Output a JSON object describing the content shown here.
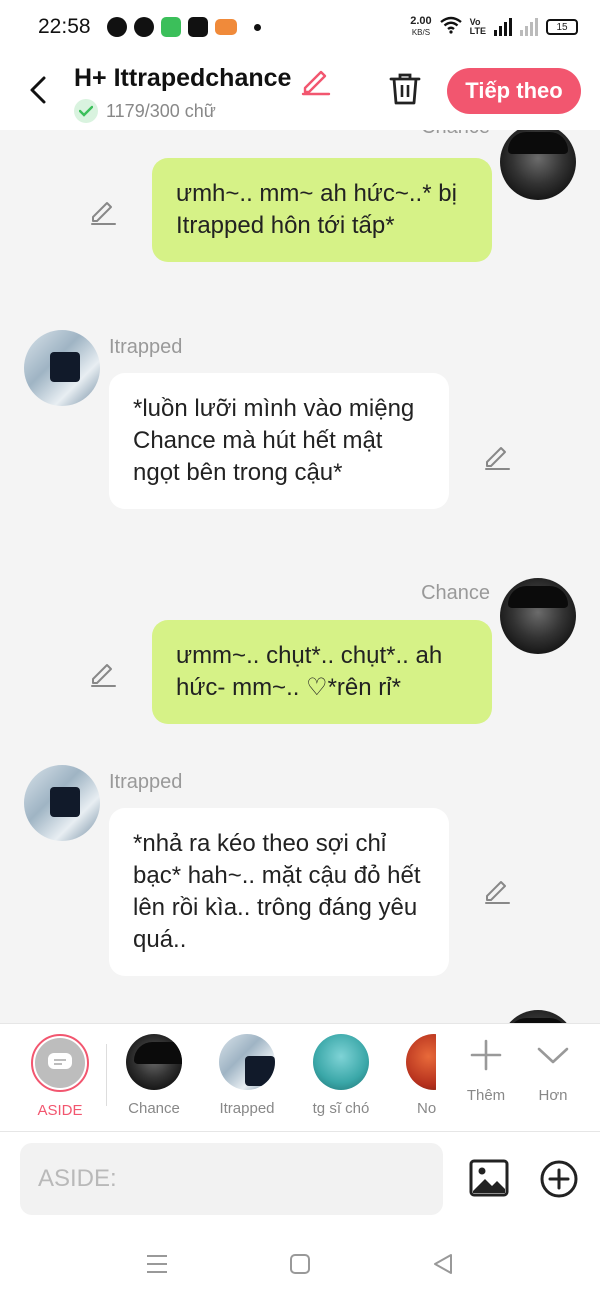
{
  "status_bar": {
    "time": "22:58",
    "speed_value": "2.00",
    "speed_unit": "KB/S",
    "volte_top": "Vo",
    "volte_bottom": "LTE",
    "battery": "15"
  },
  "header": {
    "title": "H+ Ittrapedchance",
    "word_count": "1179/300 chữ",
    "next_label": "Tiếp theo"
  },
  "messages": [
    {
      "speaker": "Chance",
      "side": "right",
      "text": "ưmh~.. mm~ ah hức~..* bị Itrapped hôn tới tấp*"
    },
    {
      "speaker": "Itrapped",
      "side": "left",
      "text": "*luồn lưỡi mình vào miệng Chance mà hút hết mật ngọt bên trong cậu*"
    },
    {
      "speaker": "Chance",
      "side": "right",
      "text": "ưmm~.. chụt*.. chụt*.. ah hức- mm~.. ♡*rên rỉ*"
    },
    {
      "speaker": "Itrapped",
      "side": "left",
      "text": "*nhả ra kéo theo sợi chỉ bạc* hah~.. mặt cậu đỏ hết lên rồi kìa.. trông đáng yêu quá.."
    }
  ],
  "characters": [
    {
      "name": "ASIDE",
      "selected": true
    },
    {
      "name": "Chance"
    },
    {
      "name": "Itrapped"
    },
    {
      "name": "tg sĩ chó"
    },
    {
      "name": "No"
    }
  ],
  "tools": {
    "add_label": "Thêm",
    "more_label": "Hơn"
  },
  "input": {
    "placeholder": "ASIDE:"
  },
  "colors": {
    "accent": "#f2566f",
    "green_bubble": "#d6f287",
    "check_green": "#3bbf5a"
  }
}
